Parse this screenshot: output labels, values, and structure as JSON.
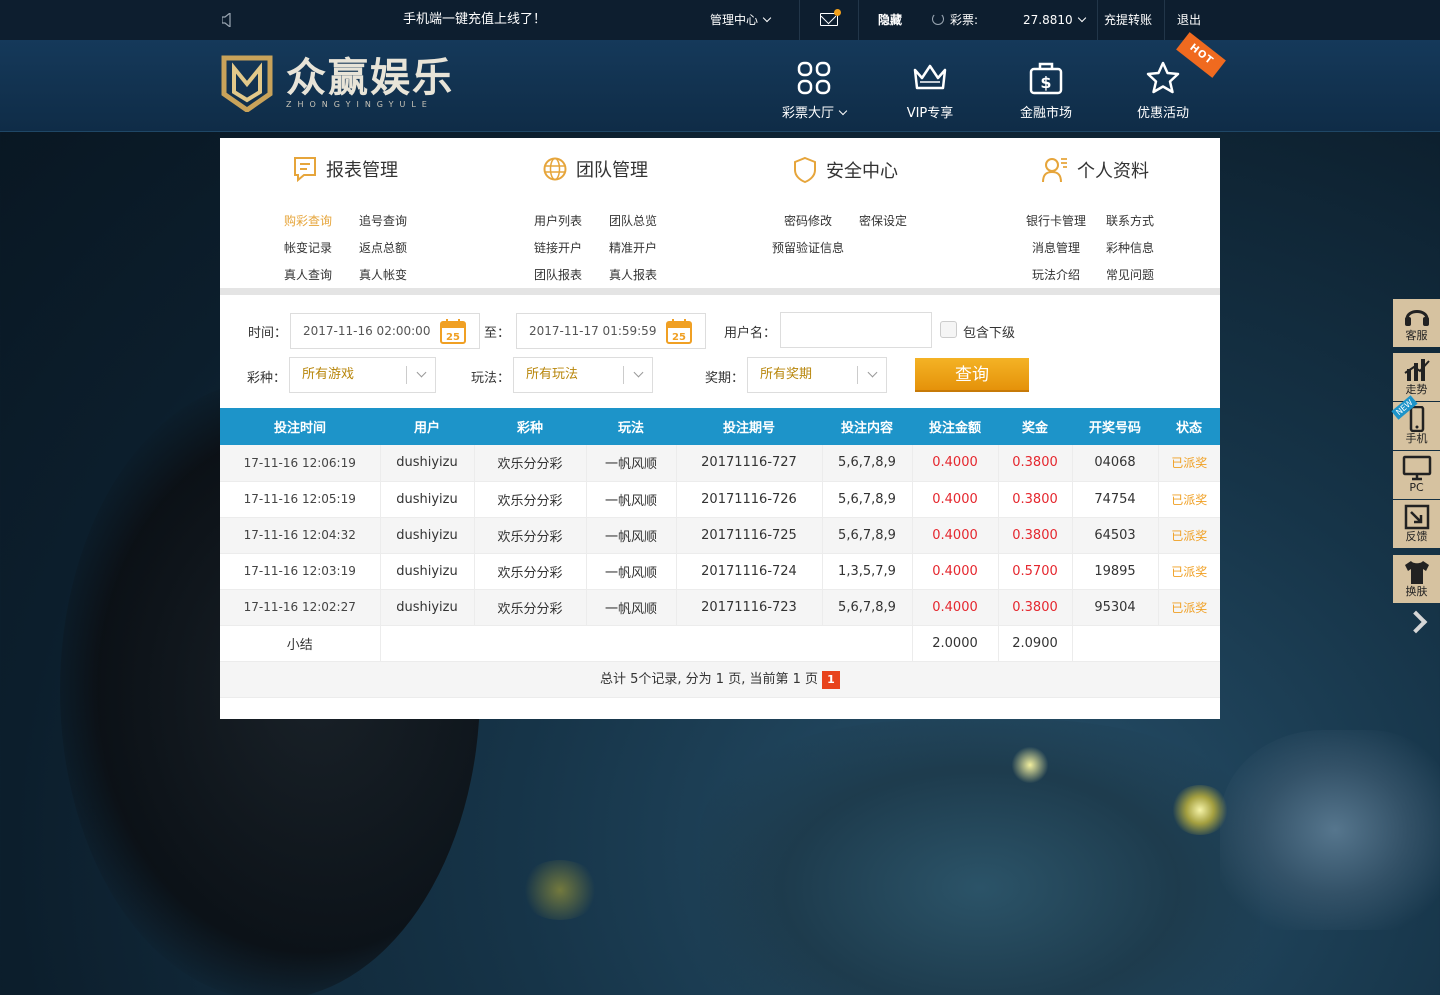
{
  "topbar": {
    "announcement": "手机端一键充值上线了！",
    "manage_center": "管理中心",
    "hide": "隐藏",
    "lottery_label": "彩票:",
    "balance": "27.8810",
    "recharge_transfer": "充提转账",
    "logout": "退出"
  },
  "logo": {
    "text": "众赢娱乐",
    "subtitle": "ZHONGYINGYULE"
  },
  "nav": {
    "items": [
      {
        "label": "彩票大厅"
      },
      {
        "label": "VIP专享"
      },
      {
        "label": "金融市场"
      },
      {
        "label": "优惠活动"
      }
    ],
    "hot_badge": "HOT"
  },
  "menu": {
    "report": {
      "title": "报表管理",
      "links": [
        "购彩查询",
        "追号查询",
        "帐变记录",
        "返点总额",
        "真人查询",
        "真人帐变"
      ]
    },
    "team": {
      "title": "团队管理",
      "links": [
        "用户列表",
        "团队总览",
        "链接开户",
        "精准开户",
        "团队报表",
        "真人报表"
      ]
    },
    "security": {
      "title": "安全中心",
      "links": [
        "密码修改",
        "密保设定",
        "预留验证信息"
      ]
    },
    "profile": {
      "title": "个人资料",
      "links": [
        "银行卡管理",
        "联系方式",
        "消息管理",
        "彩种信息",
        "玩法介绍",
        "常见问题"
      ]
    }
  },
  "filter": {
    "time_label": "时间：",
    "time_from": "2017-11-16 02:00:00",
    "to_label": "至：",
    "time_to": "2017-11-17 01:59:59",
    "calendar_day": "25",
    "username_label": "用户名：",
    "username_value": "",
    "include_sub": "包含下级",
    "lottery_label": "彩种：",
    "lottery_value": "所有游戏",
    "play_label": "玩法：",
    "play_value": "所有玩法",
    "period_label": "奖期：",
    "period_value": "所有奖期",
    "query_button": "查询"
  },
  "table": {
    "headers": [
      "投注时间",
      "用户",
      "彩种",
      "玩法",
      "投注期号",
      "投注内容",
      "投注金额",
      "奖金",
      "开奖号码",
      "状态"
    ],
    "rows": [
      [
        "17-11-16 12:06:19",
        "dushiyizu",
        "欢乐分分彩",
        "一帆风顺",
        "20171116-727",
        "5,6,7,8,9",
        "0.4000",
        "0.3800",
        "04068",
        "已派奖"
      ],
      [
        "17-11-16 12:05:19",
        "dushiyizu",
        "欢乐分分彩",
        "一帆风顺",
        "20171116-726",
        "5,6,7,8,9",
        "0.4000",
        "0.3800",
        "74754",
        "已派奖"
      ],
      [
        "17-11-16 12:04:32",
        "dushiyizu",
        "欢乐分分彩",
        "一帆风顺",
        "20171116-725",
        "5,6,7,8,9",
        "0.4000",
        "0.3800",
        "64503",
        "已派奖"
      ],
      [
        "17-11-16 12:03:19",
        "dushiyizu",
        "欢乐分分彩",
        "一帆风顺",
        "20171116-724",
        "1,3,5,7,9",
        "0.4000",
        "0.5700",
        "19895",
        "已派奖"
      ],
      [
        "17-11-16 12:02:27",
        "dushiyizu",
        "欢乐分分彩",
        "一帆风顺",
        "20171116-723",
        "5,6,7,8,9",
        "0.4000",
        "0.3800",
        "95304",
        "已派奖"
      ]
    ],
    "subtotal_label": "小结",
    "subtotal_amount": "2.0000",
    "subtotal_prize": "2.0900"
  },
  "pager": {
    "summary": "总计 5个记录, 分为 1 页, 当前第 1 页",
    "current": "1"
  },
  "sidebar": {
    "items": [
      "客服",
      "走势",
      "手机",
      "PC",
      "反馈",
      "换肤"
    ],
    "new_badge": "NEW"
  },
  "colors": {
    "header_blue": "#1d94c9",
    "accent_orange": "#f0a024",
    "amount_red": "#e5272e",
    "button_orange": "#e5920a"
  }
}
